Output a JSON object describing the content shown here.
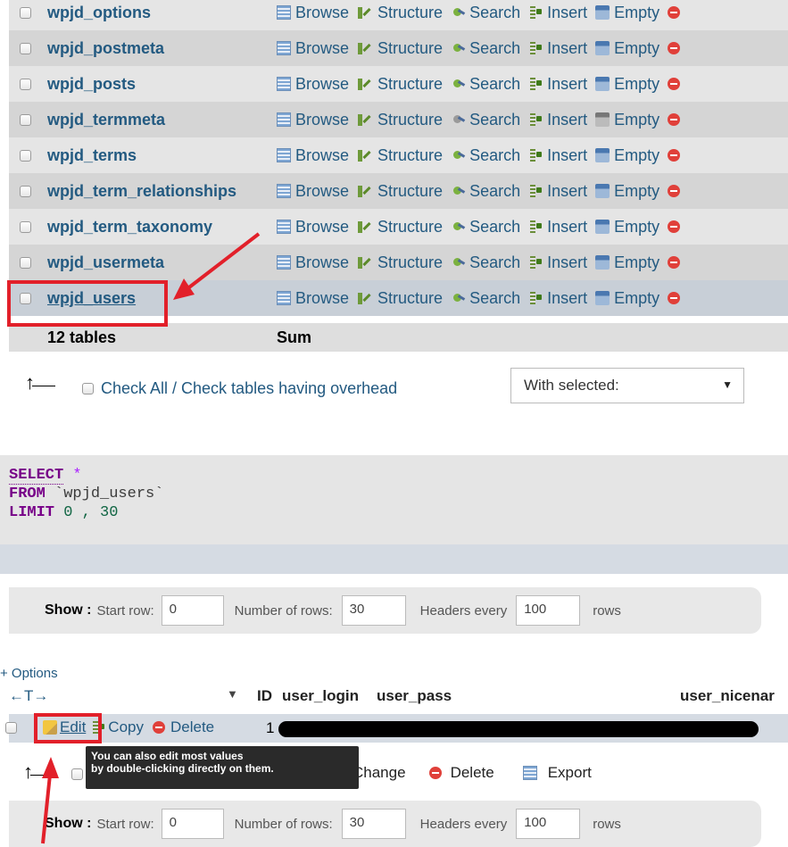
{
  "tables": [
    {
      "name": "wpjd_options"
    },
    {
      "name": "wpjd_postmeta"
    },
    {
      "name": "wpjd_posts"
    },
    {
      "name": "wpjd_termmeta"
    },
    {
      "name": "wpjd_terms"
    },
    {
      "name": "wpjd_term_relationships"
    },
    {
      "name": "wpjd_term_taxonomy"
    },
    {
      "name": "wpjd_usermeta"
    },
    {
      "name": "wpjd_users"
    }
  ],
  "actions": {
    "browse": "Browse",
    "structure": "Structure",
    "search": "Search",
    "insert": "Insert",
    "empty": "Empty"
  },
  "summary": {
    "count": "12 tables",
    "sum": "Sum"
  },
  "check_all": "Check All / Check tables having overhead",
  "with_selected": "With selected:",
  "sql": {
    "select": "SELECT",
    "star": "*",
    "from": "FROM",
    "table": "`wpjd_users`",
    "limit": "LIMIT",
    "limit_vals": "0 , 30"
  },
  "show_bar": {
    "show": "Show :",
    "start_row": "Start row:",
    "start_value": "0",
    "num_rows": "Number of rows:",
    "num_value": "30",
    "headers_every": "Headers every",
    "headers_value": "100",
    "rows": "rows"
  },
  "options_link": "+ Options",
  "arrows": "←T→",
  "columns": [
    "ID",
    "user_login",
    "user_pass",
    "user_nicenar"
  ],
  "row": {
    "edit": "Edit",
    "copy": "Copy",
    "delete": "Delete",
    "id": "1"
  },
  "tooltip": {
    "line1": "You can also edit most values",
    "line2": "by double-clicking directly on them."
  },
  "bulk": {
    "change": "Change",
    "delete": "Delete",
    "export": "Export"
  }
}
